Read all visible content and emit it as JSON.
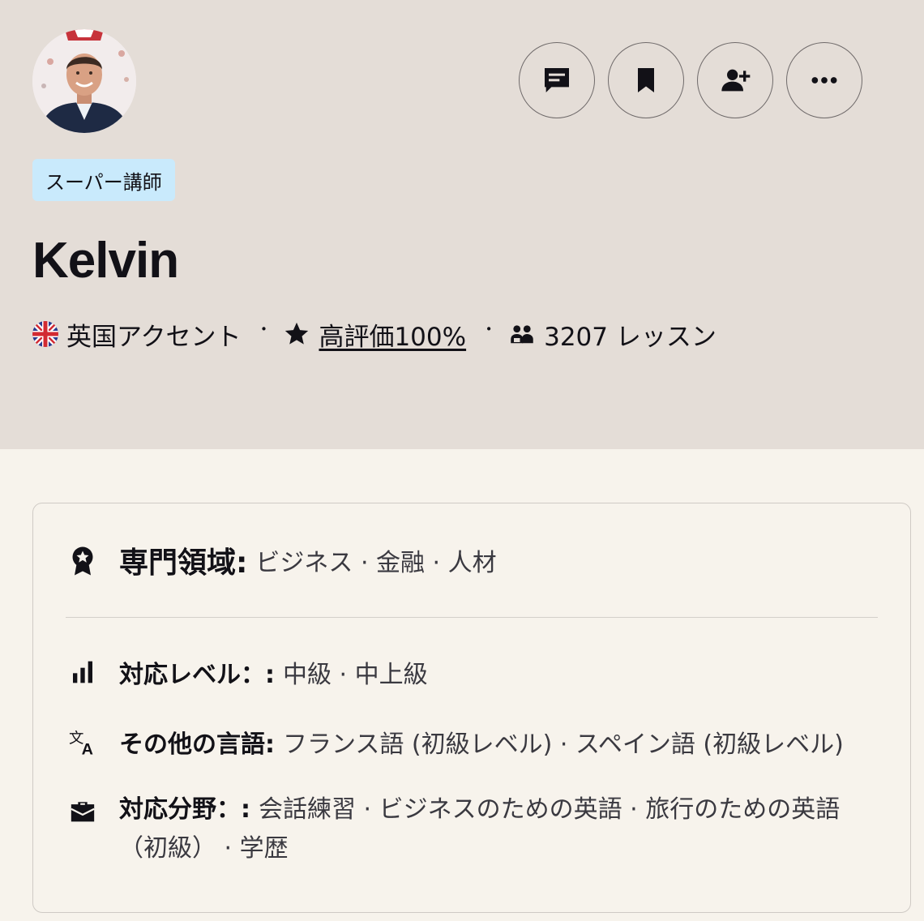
{
  "header": {
    "badge": "スーパー講師",
    "name": "Kelvin"
  },
  "actions": [
    {
      "name": "message-button",
      "icon": "message-icon"
    },
    {
      "name": "save-button",
      "icon": "bookmark-icon"
    },
    {
      "name": "follow-button",
      "icon": "add-person-icon"
    },
    {
      "name": "more-button",
      "icon": "more-icon"
    }
  ],
  "meta": {
    "accent": "英国アクセント",
    "separator": "・",
    "rating": "高評価100%",
    "lessons": "3207 レッスン"
  },
  "details": {
    "specialty_label": "専門領域:",
    "specialty_value": "ビジネス · 金融 · 人材",
    "level_label": "対応レベル：:",
    "level_value": "中級 · 中上級",
    "languages_label": "その他の言語:",
    "languages_value": "フランス語 (初級レベル) · スペイン語 (初級レベル)",
    "fields_label": "対応分野：:",
    "fields_value": "会話練習 · ビジネスのための英語 · 旅行のための英語（初級） · 学歴"
  },
  "colors": {
    "hero_bg": "#e4ddd7",
    "page_bg": "#f7f3ec",
    "badge_bg": "#c9eafc"
  }
}
